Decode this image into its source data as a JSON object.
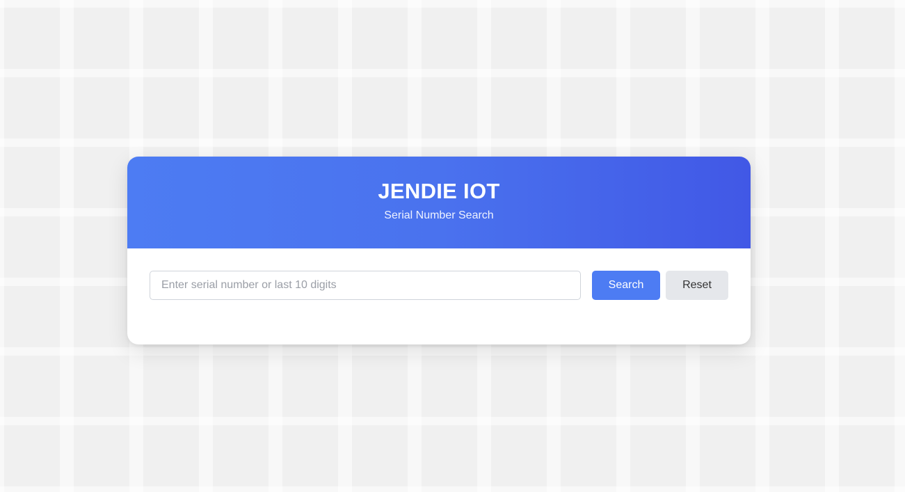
{
  "header": {
    "title": "JENDIE IOT",
    "subtitle": "Serial Number Search"
  },
  "search": {
    "placeholder": "Enter serial number or last 10 digits",
    "value": "",
    "search_label": "Search",
    "reset_label": "Reset"
  },
  "colors": {
    "accent": "#4d7cf3",
    "header_gradient_start": "#4d7cf3",
    "header_gradient_end": "#4158e6",
    "reset_button_bg": "#e5e7eb",
    "page_background": "#f5f6f8"
  }
}
